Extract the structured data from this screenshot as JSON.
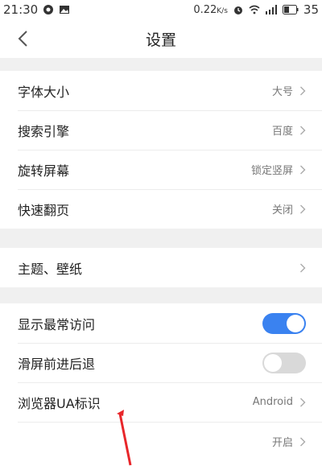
{
  "status_bar": {
    "time": "21:30",
    "network_speed": "0.22",
    "battery": "35"
  },
  "header": {
    "title": "设置",
    "back_icon": "chevron-left-icon"
  },
  "groups": [
    {
      "rows": [
        {
          "label": "字体大小",
          "value": "大号"
        },
        {
          "label": "搜索引擎",
          "value": "百度"
        },
        {
          "label": "旋转屏幕",
          "value": "锁定竖屏"
        },
        {
          "label": "快速翻页",
          "value": "关闭"
        }
      ]
    },
    {
      "rows": [
        {
          "label": "主题、壁纸",
          "value": ""
        }
      ]
    },
    {
      "rows": [
        {
          "label": "显示最常访问",
          "toggle": true
        },
        {
          "label": "滑屏前进后退",
          "toggle": false
        },
        {
          "label": "浏览器UA标识",
          "value": "Android"
        },
        {
          "label": "",
          "value": "开启"
        }
      ]
    }
  ],
  "colors": {
    "accent": "#3a82f0",
    "annotation_arrow": "#e8262a"
  }
}
